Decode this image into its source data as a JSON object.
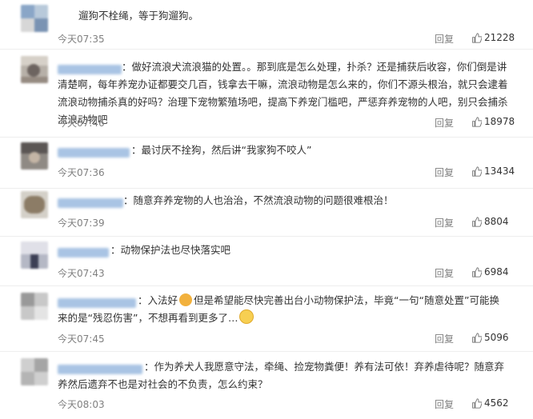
{
  "actions": {
    "reply_label": "回复"
  },
  "comments": [
    {
      "text": "遛狗不栓绳，等于狗遛狗。",
      "time": "今天07:35",
      "likes": "21228"
    },
    {
      "prefix": "：",
      "text": "做好流浪犬流浪猫的处置。。那到底是怎么处理，扑杀？还是捕获后收容，你们倒是讲清楚啊，每年养宠办证都要交几百，钱拿去干嘛，流浪动物是怎么来的，你们不源头根治，就只会逮着流浪动物捕杀真的好吗？治理下宠物繁殖场吧，提高下养宠门槛吧，严惩弃养宠物的人吧，别只会捕杀流浪动物吧",
      "time": "今天07:46",
      "likes": "18978"
    },
    {
      "prefix": "：",
      "text": "最讨厌不拴狗，然后讲“我家狗不咬人”",
      "time": "今天07:36",
      "likes": "13434"
    },
    {
      "prefix": "：",
      "text": "随意弃养宠物的人也治治，不然流浪动物的问题很难根治！",
      "time": "今天07:39",
      "likes": "8804"
    },
    {
      "prefix": "：",
      "text": "动物保护法也尽快落实吧",
      "time": "今天07:43",
      "likes": "6984"
    },
    {
      "prefix": "：",
      "text_a": "入法好",
      "text_b": "但是希望能尽快完善出台小动物保护法，毕竟“一句“随意处置”可能换来的是“残忍伤害”，不想再看到更多了…",
      "time": "今天07:45",
      "likes": "5096"
    },
    {
      "prefix": "：",
      "text": "作为养犬人我愿意守法，牵绳、捡宠物粪便！养有法可依！弃养虐待呢？随意弃养然后遗弃不也是对社会的不负责，怎么约束？",
      "time": "今天08:03",
      "likes": "4562"
    }
  ]
}
